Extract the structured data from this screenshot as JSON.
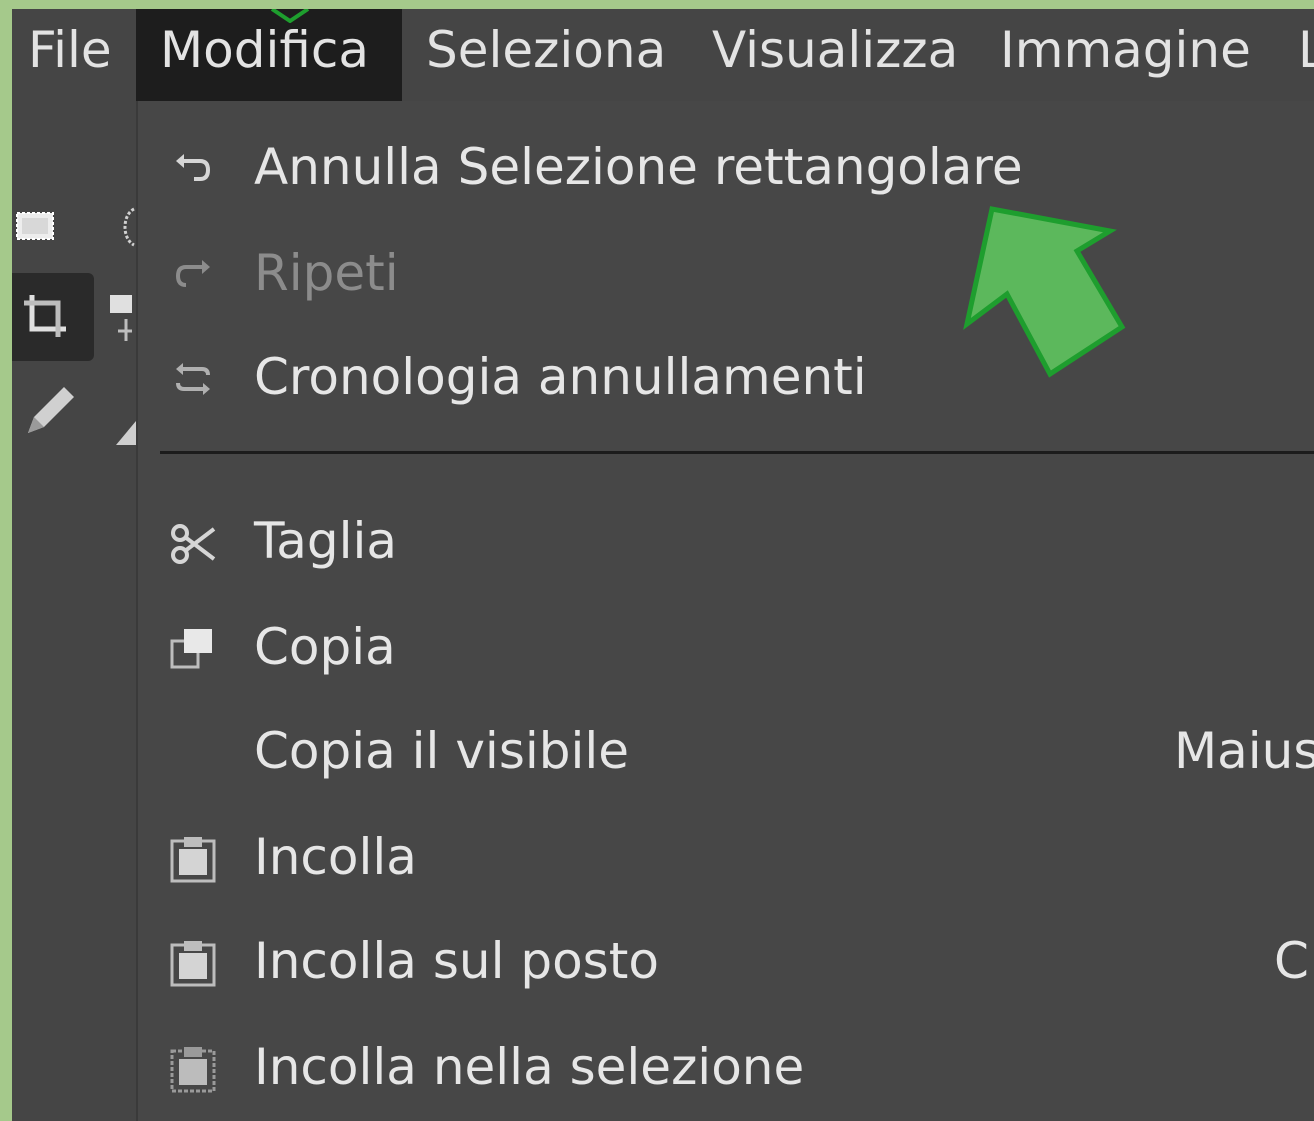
{
  "menubar": {
    "items": [
      {
        "label": "File",
        "active": false
      },
      {
        "label": "Modifica",
        "active": true
      },
      {
        "label": "Seleziona",
        "active": false
      },
      {
        "label": "Visualizza",
        "active": false
      },
      {
        "label": "Immagine",
        "active": false
      },
      {
        "label": "L",
        "active": false
      }
    ]
  },
  "edit_menu": {
    "undo": {
      "label": "Annulla Selezione rettangolare",
      "icon": "undo-icon",
      "enabled": true
    },
    "redo": {
      "label": "Ripeti",
      "icon": "redo-icon",
      "enabled": false
    },
    "undo_history": {
      "label": "Cronologia annullamenti",
      "icon": "undo-history-icon",
      "enabled": true
    },
    "cut": {
      "label": "Taglia",
      "icon": "scissors-icon",
      "enabled": true
    },
    "copy": {
      "label": "Copia",
      "icon": "copy-icon",
      "enabled": true
    },
    "copy_visible": {
      "label": "Copia il visibile",
      "shortcut": "Maius",
      "enabled": true
    },
    "paste": {
      "label": "Incolla",
      "icon": "paste-icon",
      "enabled": true
    },
    "paste_in_place": {
      "label": "Incolla sul posto",
      "shortcut": "C",
      "icon": "paste-icon",
      "enabled": true
    },
    "paste_into_selection": {
      "label": "Incolla nella selezione",
      "icon": "paste-into-selection-icon",
      "enabled": true
    }
  },
  "toolbox": {
    "tools": [
      "rectangle-select-icon",
      "crop-icon",
      "pencil-icon"
    ]
  },
  "colors": {
    "background_frame": "#a5c98b",
    "menu_bg": "#474747",
    "active_menu_bg": "#1d1d1d",
    "text": "#e6e6e6",
    "disabled_text": "#8c8c8c",
    "annotation_arrow": "#5cb85c",
    "annotation_arrow_border": "#1e9e2e"
  }
}
